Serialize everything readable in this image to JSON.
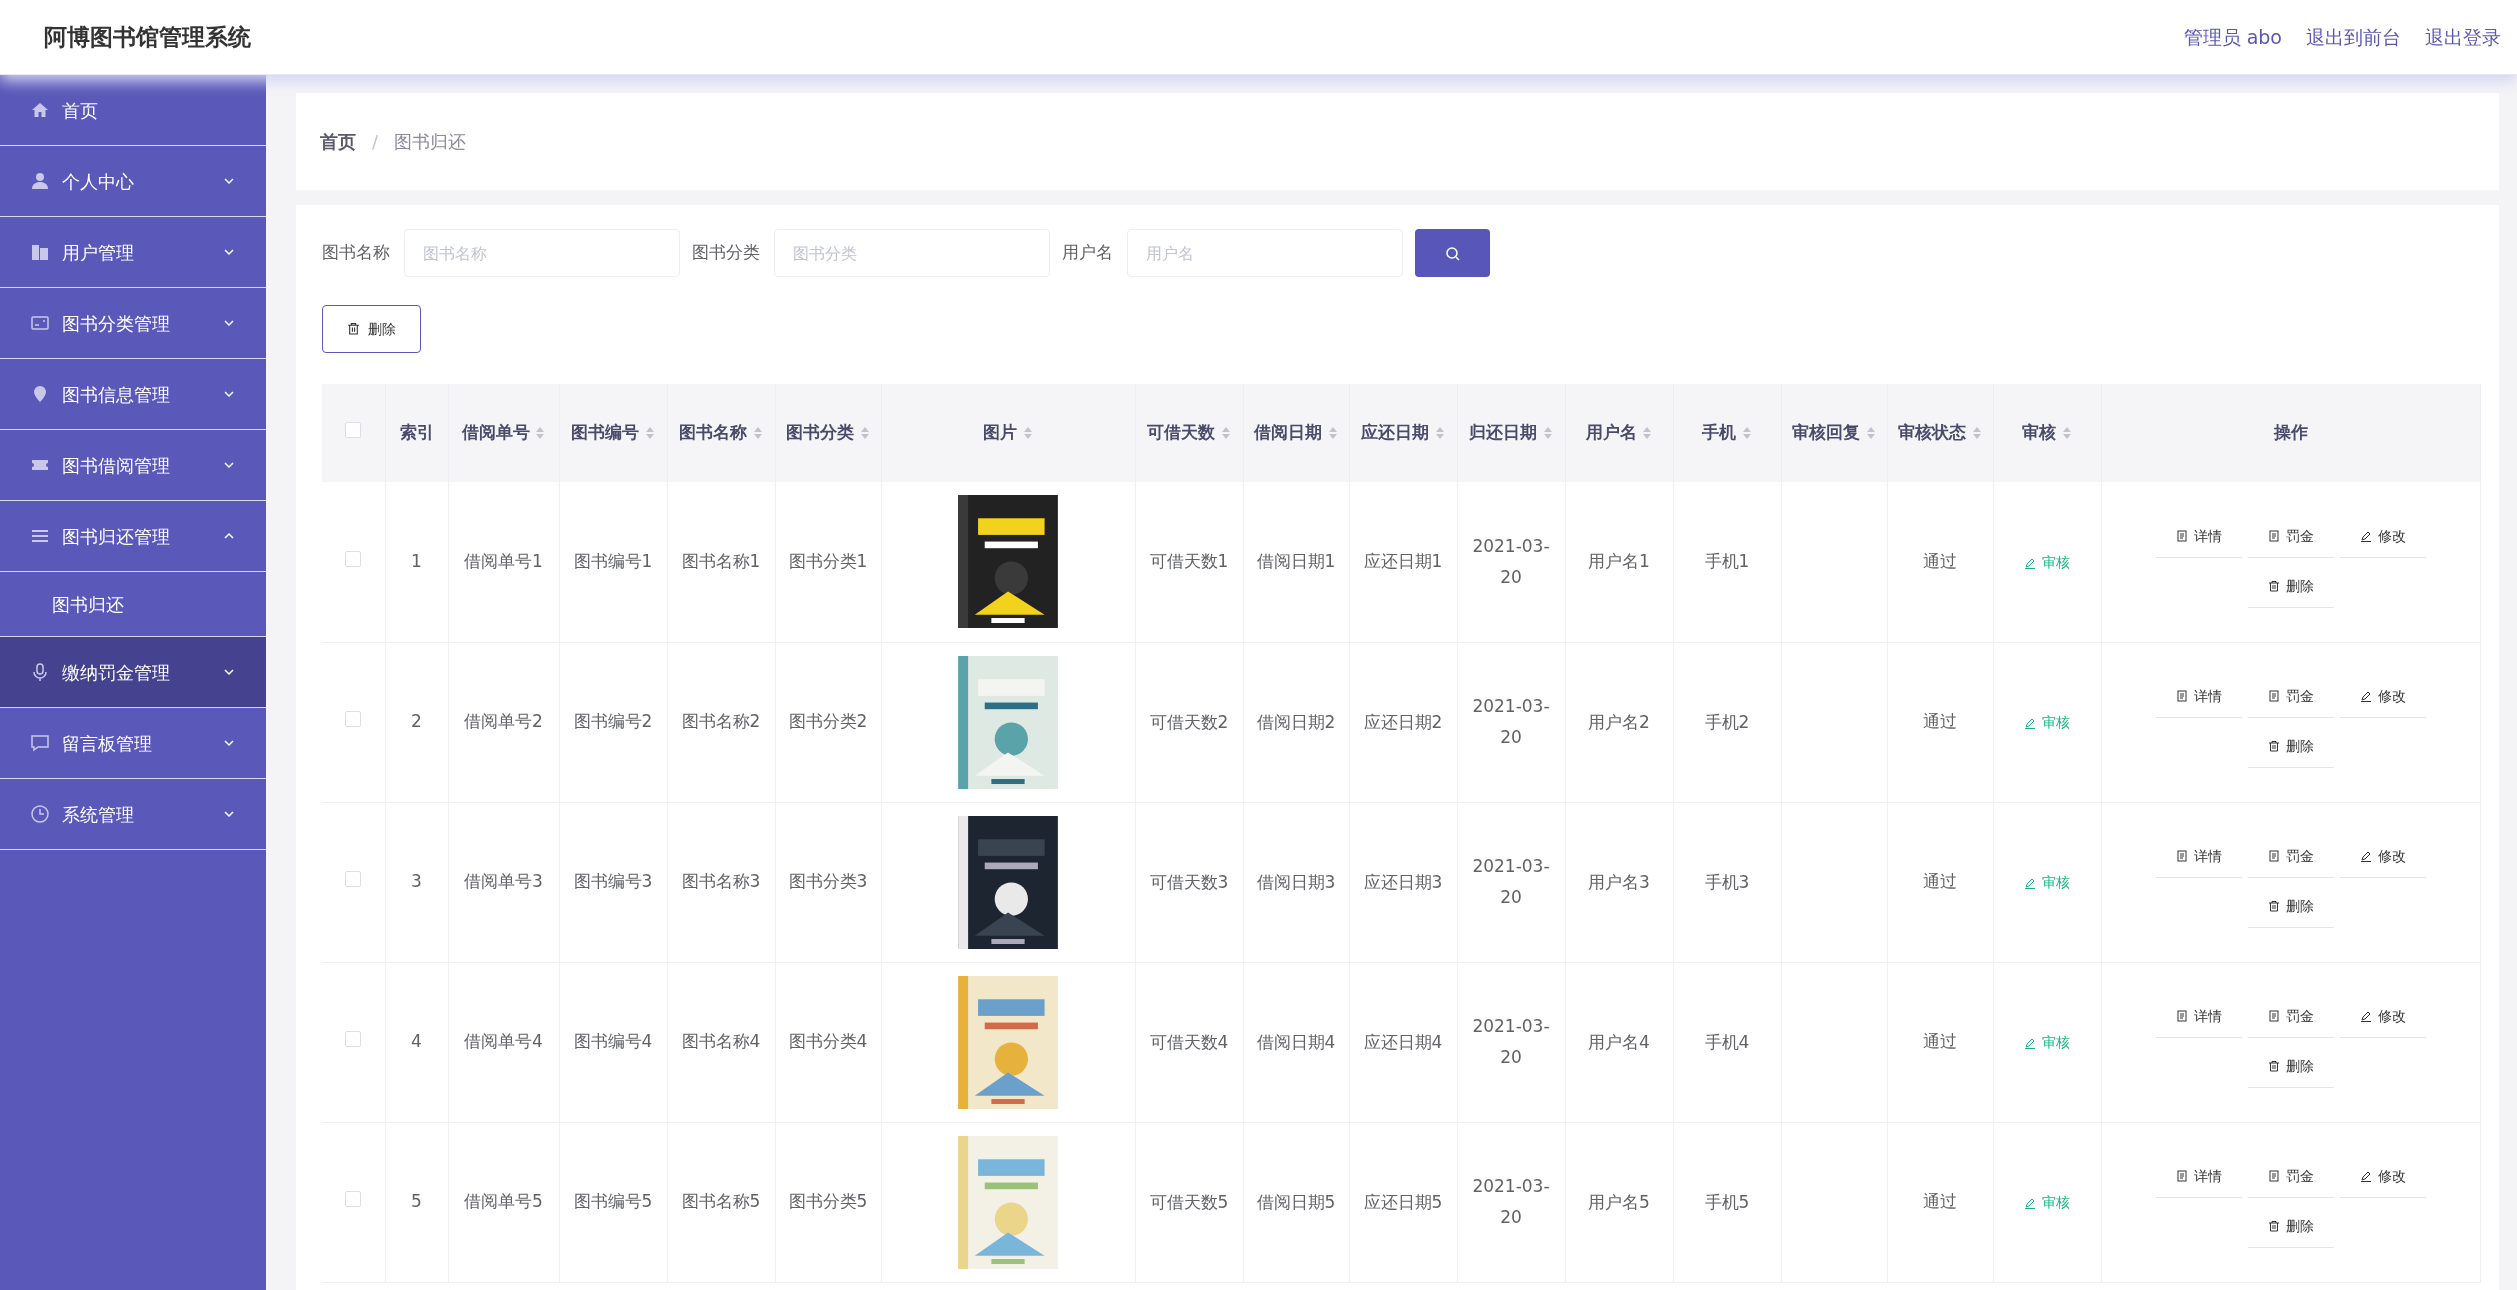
{
  "header": {
    "title": "阿博图书馆管理系统",
    "links": [
      "管理员 abo",
      "退出到前台",
      "退出登录"
    ]
  },
  "sidebar": {
    "items": [
      {
        "label": "首页",
        "kind": "link",
        "highlighted": false
      },
      {
        "label": "个人中心",
        "kind": "menu",
        "expanded": false,
        "highlighted": false
      },
      {
        "label": "用户管理",
        "kind": "menu",
        "expanded": false,
        "highlighted": false
      },
      {
        "label": "图书分类管理",
        "kind": "menu",
        "expanded": false,
        "highlighted": false
      },
      {
        "label": "图书信息管理",
        "kind": "menu",
        "expanded": false,
        "highlighted": false
      },
      {
        "label": "图书借阅管理",
        "kind": "menu",
        "expanded": false,
        "highlighted": false
      },
      {
        "label": "图书归还管理",
        "kind": "menu",
        "expanded": true,
        "highlighted": false,
        "children": [
          {
            "label": "图书归还"
          }
        ]
      },
      {
        "label": "缴纳罚金管理",
        "kind": "menu",
        "expanded": false,
        "highlighted": true
      },
      {
        "label": "留言板管理",
        "kind": "menu",
        "expanded": false,
        "highlighted": false
      },
      {
        "label": "系统管理",
        "kind": "menu",
        "expanded": false,
        "highlighted": false
      }
    ]
  },
  "breadcrumb": [
    "首页",
    "图书归还"
  ],
  "breadcrumb_separator": "/",
  "search": {
    "fields": [
      {
        "label": "图书名称",
        "placeholder": "图书名称"
      },
      {
        "label": "图书分类",
        "placeholder": "图书分类"
      },
      {
        "label": "用户名",
        "placeholder": "用户名"
      }
    ]
  },
  "toolbar": {
    "delete_button": "删除"
  },
  "table": {
    "select_all": {
      "checked": false
    },
    "columns": [
      {
        "label": "索引",
        "sortable": false
      },
      {
        "label": "借阅单号",
        "sortable": true
      },
      {
        "label": "图书编号",
        "sortable": true
      },
      {
        "label": "图书名称",
        "sortable": true
      },
      {
        "label": "图书分类",
        "sortable": true
      },
      {
        "label": "图片",
        "sortable": true
      },
      {
        "label": "可借天数",
        "sortable": true
      },
      {
        "label": "借阅日期",
        "sortable": true
      },
      {
        "label": "应还日期",
        "sortable": true
      },
      {
        "label": "归还日期",
        "sortable": true
      },
      {
        "label": "用户名",
        "sortable": true
      },
      {
        "label": "手机",
        "sortable": true
      },
      {
        "label": "审核回复",
        "sortable": true
      },
      {
        "label": "审核状态",
        "sortable": true
      },
      {
        "label": "审核",
        "sortable": true
      },
      {
        "label": "操作",
        "sortable": false
      }
    ],
    "rows": [
      {
        "checked": false,
        "cells": [
          "1",
          "借阅单号1",
          "图书编号1",
          "图书名称1",
          "图书分类1"
        ],
        "image": {
          "kind": "picture"
        },
        "cells2": [
          "可借天数1",
          "借阅日期1",
          "应还日期1",
          "2021-03-20",
          "用户名1",
          "手机1"
        ],
        "status": "通过",
        "review": "审核",
        "actions": [
          "详情",
          "罚金",
          "修改",
          "删除"
        ]
      },
      {
        "checked": false,
        "cells": [
          "2",
          "借阅单号2",
          "图书编号2",
          "图书名称2",
          "图书分类2"
        ],
        "image": {
          "kind": "picture"
        },
        "cells2": [
          "可借天数2",
          "借阅日期2",
          "应还日期2",
          "2021-03-20",
          "用户名2",
          "手机2"
        ],
        "status": "通过",
        "review": "审核",
        "actions": [
          "详情",
          "罚金",
          "修改",
          "删除"
        ]
      },
      {
        "checked": false,
        "cells": [
          "3",
          "借阅单号3",
          "图书编号3",
          "图书名称3",
          "图书分类3"
        ],
        "image": {
          "kind": "picture"
        },
        "cells2": [
          "可借天数3",
          "借阅日期3",
          "应还日期3",
          "2021-03-20",
          "用户名3",
          "手机3"
        ],
        "status": "通过",
        "review": "审核",
        "actions": [
          "详情",
          "罚金",
          "修改",
          "删除"
        ]
      },
      {
        "checked": false,
        "cells": [
          "4",
          "借阅单号4",
          "图书编号4",
          "图书名称4",
          "图书分类4"
        ],
        "image": {
          "kind": "picture"
        },
        "cells2": [
          "可借天数4",
          "借阅日期4",
          "应还日期4",
          "2021-03-20",
          "用户名4",
          "手机4"
        ],
        "status": "通过",
        "review": "审核",
        "actions": [
          "详情",
          "罚金",
          "修改",
          "删除"
        ]
      },
      {
        "checked": false,
        "cells": [
          "5",
          "借阅单号5",
          "图书编号5",
          "图书名称5",
          "图书分类5"
        ],
        "image": {
          "kind": "picture"
        },
        "cells2": [
          "可借天数5",
          "借阅日期5",
          "应还日期5",
          "2021-03-20",
          "用户名5",
          "手机5"
        ],
        "status": "通过",
        "review": "审核",
        "actions": [
          "详情",
          "罚金",
          "修改",
          "删除"
        ]
      }
    ]
  }
}
